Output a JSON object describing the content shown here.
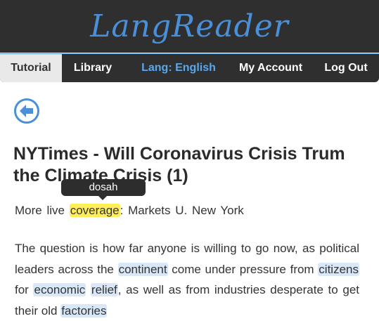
{
  "app": {
    "logo_text": "LangReader"
  },
  "nav": {
    "items": [
      {
        "label": "Tutorial",
        "active": true
      },
      {
        "label": "Library",
        "active": false
      },
      {
        "label": "Lang: English",
        "active": false
      },
      {
        "label": "My Account",
        "active": false
      },
      {
        "label": "Log Out",
        "active": false
      }
    ]
  },
  "back_icon": "arrow-left-circle-icon",
  "article": {
    "title": "NYTimes - Will Coronavirus Crisis Trum the Climate Crisis (1)",
    "tooltip": "dosah",
    "line1": {
      "before": "More live ",
      "highlighted": "coverage",
      "after": ": Markets U. New York"
    },
    "paragraph": {
      "t1": "The question is how far anyone is willing to go now, as political leaders across the ",
      "w1": "continent",
      "t2": " come under pressure from ",
      "w2": "citizens",
      "t3": " for ",
      "w3": "economic",
      "t4": " ",
      "w4": "relief",
      "t5": ", as well as from industries desperate to get their old ",
      "w5": "factories"
    }
  },
  "colors": {
    "accent": "#4a90d9",
    "header_bg": "#2f2f2f",
    "known_word_highlight": "#ffee55",
    "word_highlight": "#d8e8f8"
  }
}
